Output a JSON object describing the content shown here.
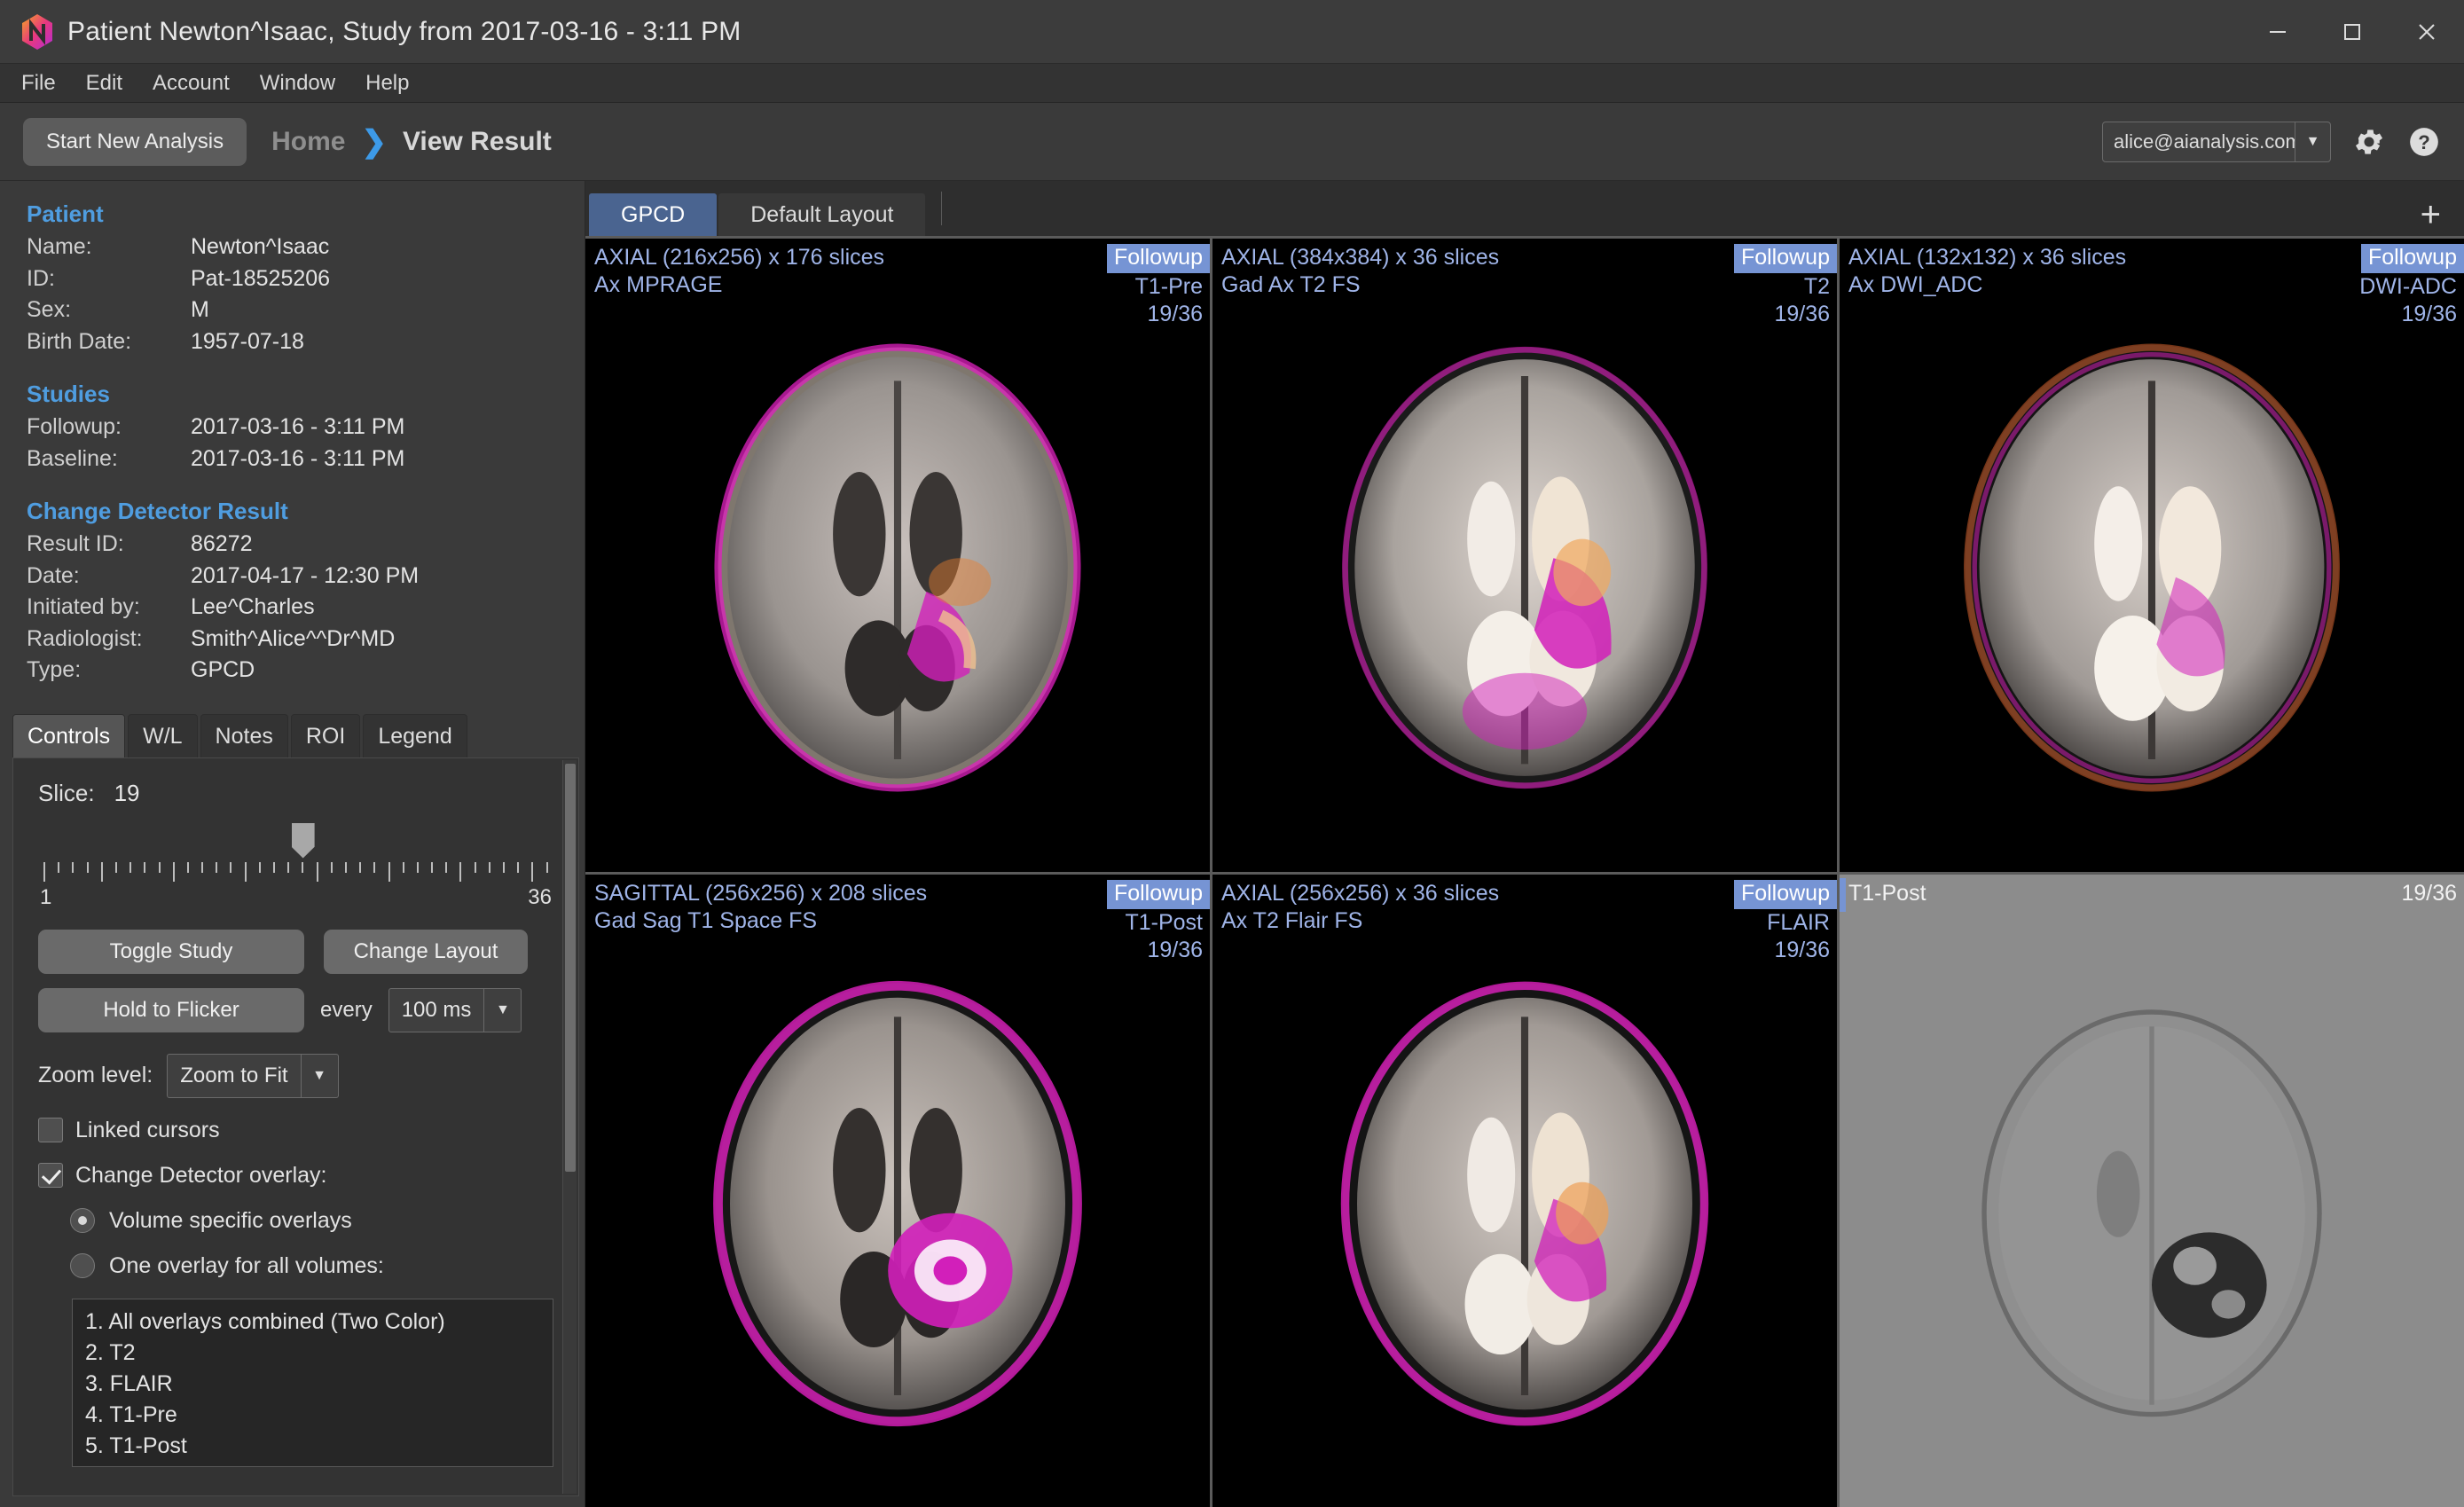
{
  "window": {
    "title": "Patient Newton^Isaac, Study from 2017-03-16 - 3:11 PM",
    "minimize": "─",
    "maximize": "☐",
    "close": "✕"
  },
  "menubar": {
    "items": [
      "File",
      "Edit",
      "Account",
      "Window",
      "Help"
    ]
  },
  "toolbar": {
    "start_new_analysis": "Start New Analysis",
    "breadcrumb": {
      "home": "Home",
      "separator": "❯",
      "current": "View Result"
    },
    "account_email": "alice@aianalysis.com",
    "dropdown_arrow": "▼"
  },
  "patient": {
    "heading": "Patient",
    "name_label": "Name:",
    "name_value": "Newton^Isaac",
    "id_label": "ID:",
    "id_value": "Pat-18525206",
    "sex_label": "Sex:",
    "sex_value": "M",
    "birth_label": "Birth Date:",
    "birth_value": "1957-07-18"
  },
  "studies": {
    "heading": "Studies",
    "followup_label": "Followup:",
    "followup_value": "2017-03-16 - 3:11 PM",
    "baseline_label": "Baseline:",
    "baseline_value": "2017-03-16 - 3:11 PM"
  },
  "change_detector_result": {
    "heading": "Change Detector Result",
    "result_id_label": "Result ID:",
    "result_id_value": "86272",
    "date_label": "Date:",
    "date_value": "2017-04-17 - 12:30 PM",
    "initiated_label": "Initiated by:",
    "initiated_value": "Lee^Charles",
    "radiologist_label": "Radiologist:",
    "radiologist_value": "Smith^Alice^^Dr^MD",
    "type_label": "Type:",
    "type_value": "GPCD"
  },
  "left_tabs": {
    "items": [
      "Controls",
      "W/L",
      "Notes",
      "ROI",
      "Legend"
    ],
    "active": "Controls"
  },
  "controls": {
    "slice_label": "Slice:",
    "slice_value": "19",
    "slider_min": "1",
    "slider_max": "36",
    "toggle_study": "Toggle Study",
    "change_layout": "Change Layout",
    "hold_to_flicker": "Hold to Flicker",
    "every_label": "every",
    "flicker_interval": "100 ms",
    "zoom_label": "Zoom level:",
    "zoom_value": "Zoom to Fit",
    "linked_cursors": "Linked cursors",
    "linked_cursors_checked": false,
    "change_detector_overlay": "Change Detector overlay:",
    "change_detector_overlay_checked": true,
    "radio_volume_specific": "Volume specific overlays",
    "radio_one_overlay": "One overlay for all volumes:",
    "radio_selected": "Volume specific overlays",
    "overlay_options": [
      "1. All overlays combined (Two Color)",
      "2. T2",
      "3. FLAIR",
      "4. T1-Pre",
      "5. T1-Post"
    ]
  },
  "view_tabs": {
    "items": [
      "GPCD",
      "Default Layout"
    ],
    "active": "GPCD",
    "add_label": "+"
  },
  "viewports": [
    {
      "geometry": "AXIAL (216x256) x 176 slices",
      "series": "Ax MPRAGE",
      "badge": "Followup",
      "sequence": "T1-Pre",
      "slice_index": "19/36",
      "style": "color"
    },
    {
      "geometry": "AXIAL (384x384) x 36 slices",
      "series": "Gad Ax T2 FS",
      "badge": "Followup",
      "sequence": "T2",
      "slice_index": "19/36",
      "style": "color"
    },
    {
      "geometry": "AXIAL (132x132) x 36 slices",
      "series": "Ax DWI_ADC",
      "badge": "Followup",
      "sequence": "DWI-ADC",
      "slice_index": "19/36",
      "style": "color"
    },
    {
      "geometry": "SAGITTAL (256x256) x 208 slices",
      "series": "Gad Sag T1 Space FS",
      "badge": "Followup",
      "sequence": "T1-Post",
      "slice_index": "19/36",
      "style": "color"
    },
    {
      "geometry": "AXIAL (256x256) x 36 slices",
      "series": "Ax T2 Flair FS",
      "badge": "Followup",
      "sequence": "FLAIR",
      "slice_index": "19/36",
      "style": "color"
    },
    {
      "geometry": "",
      "series": "",
      "badge": "",
      "sequence": "T1-Post",
      "slice_index": "19/36",
      "style": "gray"
    }
  ],
  "colors": {
    "accent_blue": "#4f9de0",
    "tab_active_blue": "#4a6490",
    "badge_blue": "#7694d4",
    "overlay_magenta": "#e020c0",
    "window_bg": "#3a3a3a"
  },
  "icons": {
    "gear": "gear-icon",
    "help": "help-icon",
    "logo": "app-logo-icon"
  }
}
